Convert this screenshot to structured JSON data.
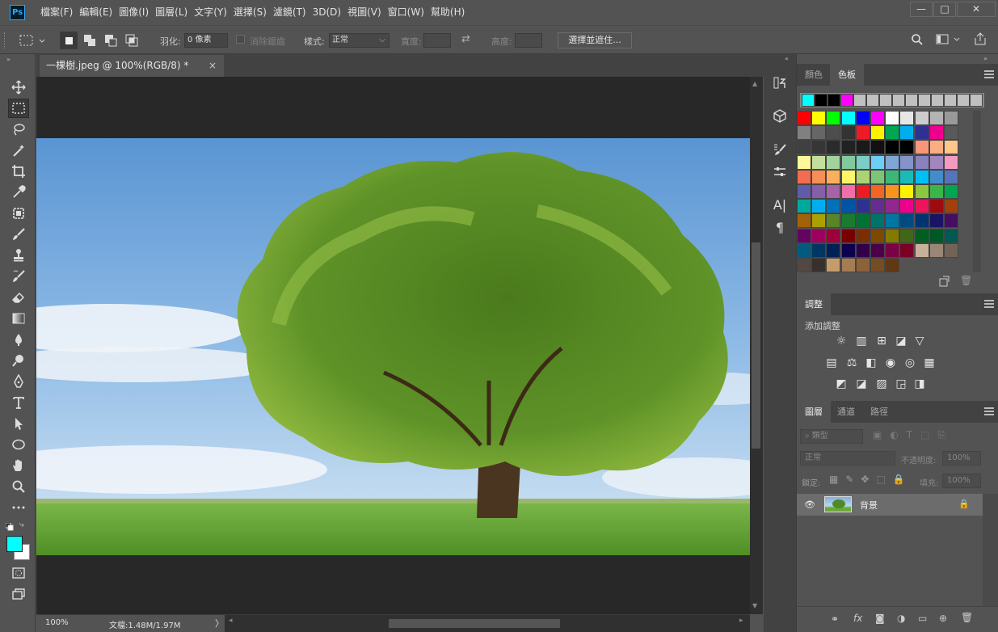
{
  "app": {
    "logo": "Ps",
    "accent": "#31a8ff"
  },
  "menu": {
    "items": [
      {
        "label": "檔案(F)"
      },
      {
        "label": "編輯(E)"
      },
      {
        "label": "圖像(I)"
      },
      {
        "label": "圖層(L)"
      },
      {
        "label": "文字(Y)"
      },
      {
        "label": "選擇(S)"
      },
      {
        "label": "濾鏡(T)"
      },
      {
        "label": "3D(D)"
      },
      {
        "label": "視圖(V)"
      },
      {
        "label": "窗口(W)"
      },
      {
        "label": "幫助(H)"
      }
    ]
  },
  "window_controls": {
    "minimize": "—",
    "maximize": "□",
    "close": "✕"
  },
  "options": {
    "feather_label": "羽化:",
    "feather_value": "0 像素",
    "antialias_label": "消除鋸齒",
    "style_label": "樣式:",
    "style_value": "正常",
    "width_label": "寬度:",
    "height_label": "高度:",
    "select_mask_button": "選擇並遮住..."
  },
  "document": {
    "tab_title": "一棵樹.jpeg @ 100%(RGB/8) *",
    "tab_close": "×",
    "zoom": "100%",
    "doc_info": "文檔:1.48M/1.97M"
  },
  "tools": [
    {
      "icon": "move-icon"
    },
    {
      "icon": "marquee-icon"
    },
    {
      "icon": "lasso-icon"
    },
    {
      "icon": "quick-select-icon"
    },
    {
      "icon": "crop-icon"
    },
    {
      "icon": "eyedropper-icon"
    },
    {
      "icon": "healing-icon"
    },
    {
      "icon": "brush-icon"
    },
    {
      "icon": "stamp-icon"
    },
    {
      "icon": "history-brush-icon"
    },
    {
      "icon": "eraser-icon"
    },
    {
      "icon": "gradient-icon"
    },
    {
      "icon": "blur-icon"
    },
    {
      "icon": "dodge-icon"
    },
    {
      "icon": "pen-icon"
    },
    {
      "icon": "type-icon"
    },
    {
      "icon": "path-select-icon"
    },
    {
      "icon": "ellipse-icon"
    },
    {
      "icon": "hand-icon"
    },
    {
      "icon": "zoom-icon"
    },
    {
      "icon": "more-icon"
    }
  ],
  "colors": {
    "foreground": "#00ffff",
    "background": "#ffffff"
  },
  "swatches_panel": {
    "tab_color": "顏色",
    "tab_swatches": "色板",
    "recent": [
      "#00ffff",
      "#000000",
      "#000000",
      "#ff00ff",
      "#c0c0c0",
      "#c0c0c0",
      "#c0c0c0",
      "#c0c0c0",
      "#c0c0c0",
      "#c0c0c0",
      "#c0c0c0",
      "#c0c0c0",
      "#c0c0c0",
      "#c0c0c0"
    ],
    "grid": [
      [
        "#ff0000",
        "#ffff00",
        "#00ff00",
        "#00ffff",
        "#0000ff",
        "#ff00ff",
        "#ffffff",
        "#e6e6e6",
        "#cccccc",
        "#b3b3b3",
        "#999999"
      ],
      [
        "#808080",
        "#666666",
        "#4d4d4d",
        "#333333",
        "#ed1c24",
        "#fff200",
        "#00a651",
        "#00aeef",
        "#2e3192",
        "#ec008c",
        "#595959"
      ],
      [
        "#404040",
        "#363636",
        "#2b2b2b",
        "#212121",
        "#1a1a1a",
        "#111111",
        "#000000",
        "#000000",
        "#f7977a",
        "#f9ad81",
        "#fdc68a"
      ],
      [
        "#fff799",
        "#c4df9b",
        "#a3d39c",
        "#82ca9d",
        "#7bcdc8",
        "#6ecff6",
        "#7ea7d8",
        "#8493ca",
        "#8882be",
        "#a187be",
        "#f49ac2"
      ],
      [
        "#f26c4f",
        "#f68e55",
        "#fbaf5c",
        "#fff467",
        "#acd372",
        "#7cc576",
        "#3bb878",
        "#1abbb4",
        "#00bff3",
        "#438ccb",
        "#5574b9"
      ],
      [
        "#605ca8",
        "#855fa8",
        "#a763a8",
        "#f06eaa",
        "#ed1c24",
        "#f26522",
        "#f7941d",
        "#fff200",
        "#8dc73f",
        "#39b54a",
        "#00a651"
      ],
      [
        "#00a99d",
        "#00aeef",
        "#0072bc",
        "#0054a6",
        "#2e3192",
        "#662d91",
        "#92278f",
        "#ec008c",
        "#ed145b",
        "#9e0b0f",
        "#a0410d"
      ],
      [
        "#a36209",
        "#aba000",
        "#598527",
        "#1a7b30",
        "#007236",
        "#00746b",
        "#0076a3",
        "#004b80",
        "#003471",
        "#1b1464",
        "#440e62"
      ],
      [
        "#630460",
        "#9e005d",
        "#9e0039",
        "#790000",
        "#7b2e00",
        "#7d4900",
        "#827b00",
        "#406618",
        "#005e20",
        "#005826",
        "#005952"
      ],
      [
        "#005b7f",
        "#003663",
        "#002157",
        "#0d004c",
        "#32004b",
        "#4b0049",
        "#7b0046",
        "#7a0026",
        "#c7b299",
        "#998675",
        "#736357"
      ],
      [
        "#534741",
        "#37302d",
        "#c69c6d",
        "#a67c52",
        "#8c6239",
        "#754c24",
        "#603913"
      ]
    ]
  },
  "adjustments_panel": {
    "tab": "調整",
    "add_label": "添加調整",
    "row1": [
      "☼",
      "▥",
      "⊞",
      "◪",
      "▽"
    ],
    "row2": [
      "▤",
      "⚖",
      "◧",
      "◉",
      "◎",
      "▦"
    ],
    "row3": [
      "◩",
      "◪",
      "▨",
      "◲",
      "◨"
    ]
  },
  "layers_panel": {
    "tab_layers": "圖層",
    "tab_channels": "通道",
    "tab_paths": "路徑",
    "kind_filter": "類型",
    "blend_mode": "正常",
    "opacity_label": "不透明度:",
    "opacity_value": "100%",
    "lock_label": "鎖定:",
    "fill_label": "填充:",
    "fill_value": "100%",
    "layer_name": "背景",
    "footer": [
      "⚭",
      "fx",
      "◙",
      "◑",
      "▭",
      "⊕",
      "🗑"
    ]
  }
}
